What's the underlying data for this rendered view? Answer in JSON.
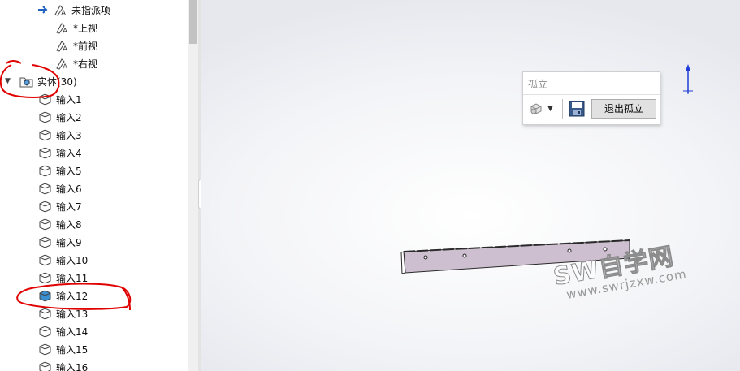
{
  "tree": {
    "items": [
      {
        "label": "未指派项",
        "icon": "arrow-annotation-icon"
      },
      {
        "label": "*上视",
        "icon": "annotation-view-icon"
      },
      {
        "label": "*前视",
        "icon": "annotation-view-icon"
      },
      {
        "label": "*右视",
        "icon": "annotation-view-icon"
      }
    ],
    "solids_folder": {
      "label": "实体(30)",
      "expanded": true
    },
    "bodies": [
      {
        "label": "输入1"
      },
      {
        "label": "输入2"
      },
      {
        "label": "输入3"
      },
      {
        "label": "输入4"
      },
      {
        "label": "输入5"
      },
      {
        "label": "输入6"
      },
      {
        "label": "输入7"
      },
      {
        "label": "输入8"
      },
      {
        "label": "输入9"
      },
      {
        "label": "输入10"
      },
      {
        "label": "输入11"
      },
      {
        "label": "输入12",
        "selected": true
      },
      {
        "label": "输入13"
      },
      {
        "label": "输入14"
      },
      {
        "label": "输入15"
      },
      {
        "label": "输入16"
      }
    ]
  },
  "isolate_panel": {
    "title": "孤立",
    "visibility_icon": "display-style-icon",
    "save_icon": "save-icon",
    "exit_label": "退出孤立"
  },
  "watermark": {
    "main": "SW自学网",
    "sub": "www.swrjzxw.com"
  },
  "colors": {
    "part_fill": "#cdbfcf",
    "annotation": "#e00000",
    "selected_body": "#3a8fd1"
  }
}
